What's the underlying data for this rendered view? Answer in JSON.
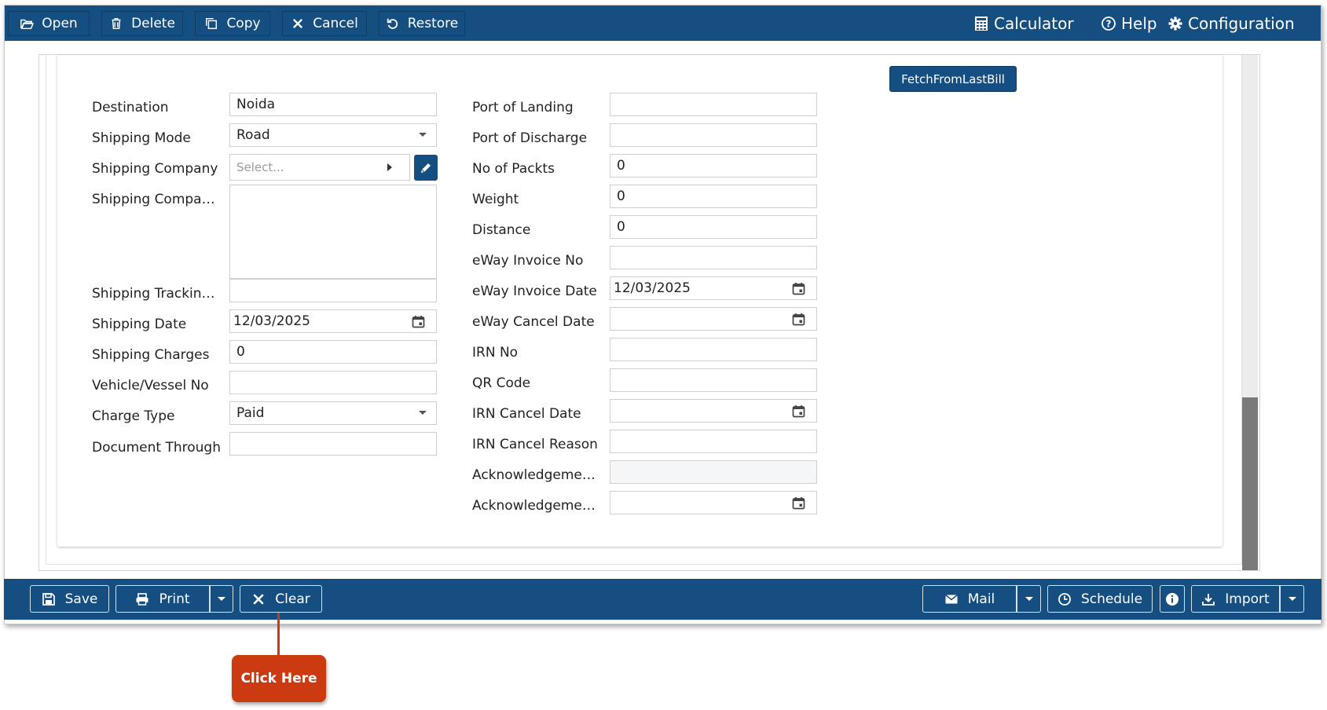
{
  "toolbar": {
    "open": "Open",
    "delete": "Delete",
    "copy": "Copy",
    "cancel": "Cancel",
    "restore": "Restore",
    "calculator": "Calculator",
    "help": "Help",
    "configuration": "Configuration"
  },
  "fetch_button": "FetchFromLastBill",
  "left_form": {
    "destination": {
      "label": "Destination",
      "value": "Noida"
    },
    "shipping_mode": {
      "label": "Shipping Mode",
      "value": "Road"
    },
    "shipping_company": {
      "label": "Shipping Company",
      "placeholder": "Select..."
    },
    "shipping_company_details": {
      "label": "Shipping Compan...",
      "value": ""
    },
    "shipping_tracking": {
      "label": "Shipping Tracking ...",
      "value": ""
    },
    "shipping_date": {
      "label": "Shipping Date",
      "value": "12/03/2025"
    },
    "shipping_charges": {
      "label": "Shipping Charges",
      "value": "0"
    },
    "vehicle_no": {
      "label": "Vehicle/Vessel No",
      "value": ""
    },
    "charge_type": {
      "label": "Charge Type",
      "value": "Paid"
    },
    "document_through": {
      "label": "Document Through",
      "value": ""
    }
  },
  "right_form": {
    "port_landing": {
      "label": "Port of Landing",
      "value": ""
    },
    "port_discharge": {
      "label": "Port of Discharge",
      "value": ""
    },
    "no_packts": {
      "label": "No of Packts",
      "value": "0"
    },
    "weight": {
      "label": "Weight",
      "value": "0"
    },
    "distance": {
      "label": "Distance",
      "value": "0"
    },
    "eway_invoice_no": {
      "label": "eWay Invoice No",
      "value": ""
    },
    "eway_invoice_date": {
      "label": "eWay Invoice Date",
      "value": "12/03/2025"
    },
    "eway_cancel_date": {
      "label": "eWay Cancel Date",
      "value": ""
    },
    "irn_no": {
      "label": "IRN No",
      "value": ""
    },
    "qr_code": {
      "label": "QR Code",
      "value": ""
    },
    "irn_cancel_date": {
      "label": "IRN Cancel Date",
      "value": ""
    },
    "irn_cancel_reason": {
      "label": "IRN Cancel Reason",
      "value": ""
    },
    "ack_no": {
      "label": "Acknowledgemen...",
      "value": ""
    },
    "ack_date": {
      "label": "Acknowledgemen...",
      "value": ""
    }
  },
  "bottombar": {
    "save": "Save",
    "print": "Print",
    "clear": "Clear",
    "mail": "Mail",
    "schedule": "Schedule",
    "import": "Import"
  },
  "callout": "Click Here",
  "colors": {
    "primary": "#154e80",
    "callout": "#cc3a12"
  }
}
